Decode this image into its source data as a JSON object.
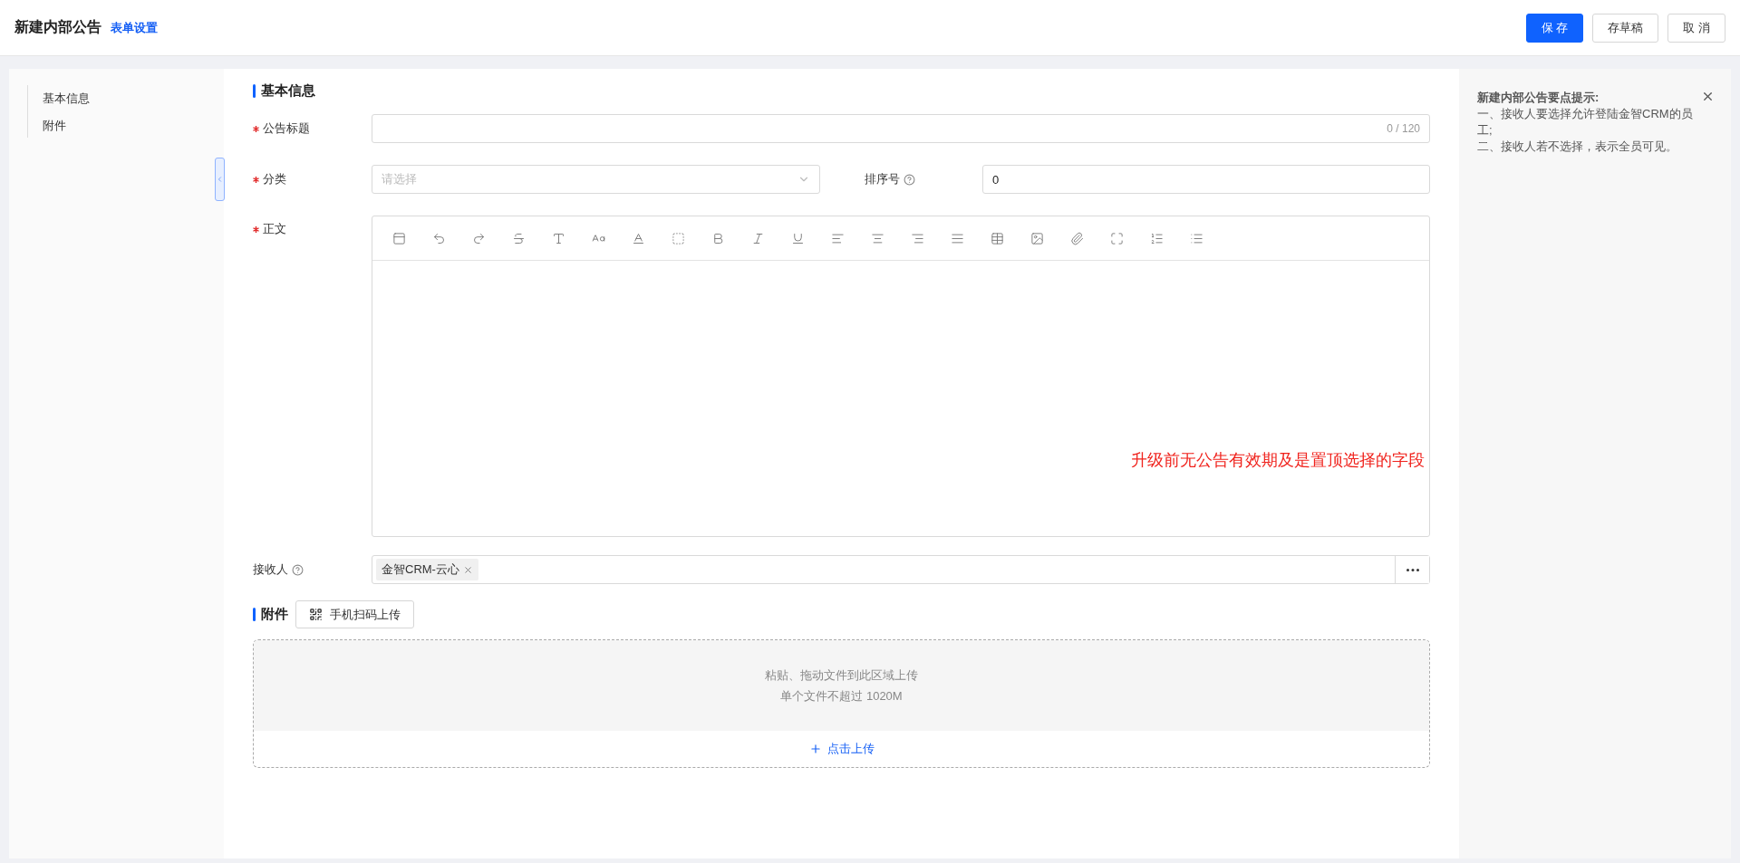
{
  "header": {
    "title": "新建内部公告",
    "link": "表单设置",
    "buttons": [
      {
        "label": "保 存",
        "kind": "primary"
      },
      {
        "label": "存草稿",
        "kind": "default"
      },
      {
        "label": "取 消",
        "kind": "default"
      }
    ]
  },
  "nav": {
    "items": [
      {
        "label": "基本信息"
      },
      {
        "label": "附件"
      }
    ]
  },
  "section_basic": {
    "title": "基本信息"
  },
  "fields": {
    "title": {
      "label": "公告标题",
      "required": true,
      "counter": "0 / 120"
    },
    "category": {
      "label": "分类",
      "required": true,
      "placeholder": "请选择"
    },
    "sort": {
      "label": "排序号",
      "value": "0"
    },
    "body": {
      "label": "正文",
      "required": true
    },
    "receiver": {
      "label": "接收人",
      "tags": [
        "金智CRM-云心"
      ]
    }
  },
  "annotation": "升级前无公告有效期及是置顶选择的字段",
  "section_attach": {
    "title": "附件",
    "scan_button": "手机扫码上传",
    "drop_hint": "粘贴、拖动文件到此区域上传",
    "size_hint": "单个文件不超过 1020M",
    "upload_link": "点击上传"
  },
  "tips": {
    "title": "新建内部公告要点提示:",
    "lines": [
      "一、接收人要选择允许登陆金智CRM的员工;",
      "二、接收人若不选择，表示全员可见。"
    ]
  }
}
